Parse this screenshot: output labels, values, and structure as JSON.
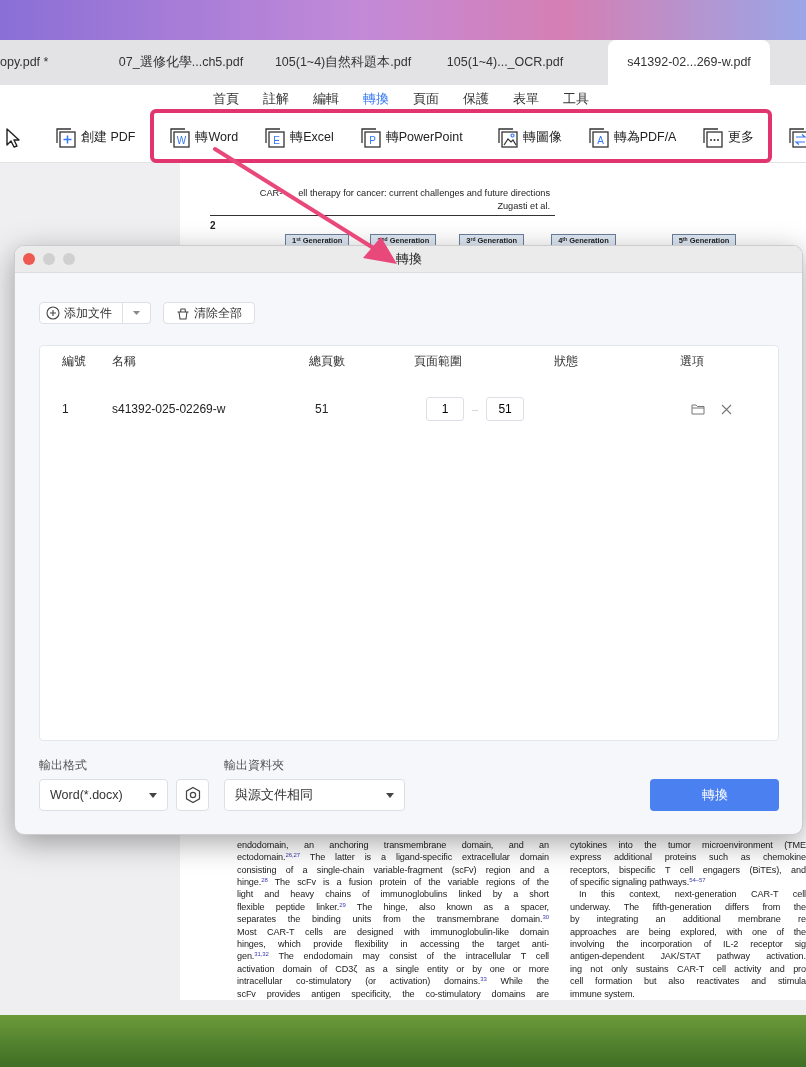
{
  "tabs": [
    {
      "label": "opy.pdf *",
      "selected": false
    },
    {
      "label": "07_選修化學...ch5.pdf",
      "selected": false
    },
    {
      "label": "105(1~4)自然科題本.pdf",
      "selected": false
    },
    {
      "label": "105(1~4)..._OCR.pdf",
      "selected": false
    },
    {
      "label": "s41392-02...269-w.pdf",
      "selected": true
    }
  ],
  "menu": [
    {
      "label": "首頁",
      "selected": false
    },
    {
      "label": "註解",
      "selected": false
    },
    {
      "label": "編輯",
      "selected": false
    },
    {
      "label": "轉換",
      "selected": true
    },
    {
      "label": "頁面",
      "selected": false
    },
    {
      "label": "保護",
      "selected": false
    },
    {
      "label": "表單",
      "selected": false
    },
    {
      "label": "工具",
      "selected": false
    }
  ],
  "toolbar": [
    [
      {
        "kind": "cursor"
      }
    ],
    [
      {
        "kind": "plus",
        "label": "創建 PDF"
      }
    ],
    [
      {
        "kind": "letter",
        "letter": "W",
        "label": "轉Word"
      },
      {
        "kind": "letter",
        "letter": "E",
        "label": "轉Excel"
      },
      {
        "kind": "letter",
        "letter": "P",
        "label": "轉PowerPoint"
      }
    ],
    [
      {
        "kind": "image",
        "label": "轉圖像"
      },
      {
        "kind": "letter",
        "letter": "A",
        "label": "轉為PDF/A"
      },
      {
        "kind": "dots",
        "label": "更多"
      }
    ],
    [
      {
        "kind": "swap"
      }
    ]
  ],
  "document": {
    "header": [
      "CAR-",
      "ell therapy for cancer: current challenges and future directions"
    ],
    "authors": "Zugasti et al.",
    "page_number": "2",
    "generations": [
      "1$^{st}$ Generation",
      "2$^{nd}$ Generation",
      "3$^{rd}$ Generation",
      "4$^{th}$ Generation",
      "5$^{th}$ Generation"
    ],
    "left_column": [
      {
        "kind": "full",
        "text": "endodomain, an anchoring transmembrane domain, and an"
      },
      {
        "kind": "full",
        "text": "ectodomain.$^{26,27}$ The latter is a ligand-specific extracellular domain"
      },
      {
        "kind": "full",
        "text": "consisting of a single-chain variable-fragment (scFv) region and a"
      },
      {
        "kind": "full",
        "text": "hinge.$^{28}$ The scFv is a fusion protein of the variable regions of the"
      },
      {
        "kind": "full",
        "text": "light and heavy chains of immunoglobulins linked by a short"
      },
      {
        "kind": "full",
        "text": "flexible peptide linker.$^{29}$ The hinge, also known as a spacer,"
      },
      {
        "kind": "full",
        "text": "separates the binding units from the transmembrane domain.$^{30}$"
      },
      {
        "kind": "full",
        "text": "Most CAR-T cells are designed with immunoglobulin-like domain"
      },
      {
        "kind": "full",
        "text": "hinges, which provide flexibility in accessing the target anti-"
      },
      {
        "kind": "full",
        "text": "gen.$^{31,32}$ The endodomain may consist of the intracellular T cell"
      },
      {
        "kind": "full",
        "text": "activation domain of CD3ζ as a single entity or by one or more"
      },
      {
        "kind": "full",
        "text": "intracellular co-stimulatory (or activation) domains.$^{33}$ While the"
      },
      {
        "kind": "full",
        "text": "scFv provides antigen specificity, the co-stimulatory domains are"
      }
    ],
    "right_column": [
      {
        "kind": "full",
        "text": "cytokines into the tumor microenvironment (TME"
      },
      {
        "kind": "full",
        "text": "express additional proteins such as chemokine"
      },
      {
        "kind": "full",
        "text": "receptors, bispecific T cell engagers (BiTEs), and"
      },
      {
        "kind": "end",
        "text": "of specific signaling pathways.$^{54–57}$"
      },
      {
        "kind": "indent",
        "text": "In this context, next-generation CAR-T cell"
      },
      {
        "kind": "full",
        "text": "underway. The fifth-generation differs from the"
      },
      {
        "kind": "full",
        "text": "by integrating an additional membrane re"
      },
      {
        "kind": "full",
        "text": "approaches are being explored, with one of the"
      },
      {
        "kind": "full",
        "text": "involving the incorporation of IL-2 receptor sig"
      },
      {
        "kind": "full",
        "text": "antigen-dependent JAK/STAT pathway activation."
      },
      {
        "kind": "full",
        "text": "ing not only sustains CAR-T cell activity and pro"
      },
      {
        "kind": "full",
        "text": "cell formation but also reactivates and stimula"
      },
      {
        "kind": "end",
        "text": "immune system."
      }
    ]
  },
  "dialog": {
    "title": "轉換",
    "add_button": "添加文件",
    "clear_button": "清除全部",
    "columns": [
      "編號",
      "名稱",
      "總頁數",
      "頁面範圍",
      "狀態",
      "選項"
    ],
    "rows": [
      {
        "number": "1",
        "name": "s41392-025-02269-w",
        "pages": "51",
        "range_from": "1",
        "range_separator": "–",
        "range_to": "51"
      }
    ],
    "format_label": "輸出格式",
    "format": "Word(*.docx)",
    "folder_label": "輸出資料夾",
    "folder": "與源文件相同",
    "convert_button": "轉換"
  }
}
